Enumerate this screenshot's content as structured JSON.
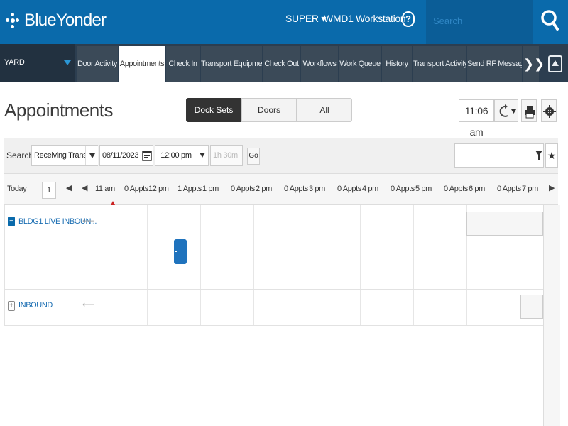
{
  "header": {
    "brand": "BlueYonder",
    "user_menu": "SUPER ▾",
    "warehouse": "WMD1",
    "workstation": "Workstation",
    "help": "?",
    "search_placeholder": "Search"
  },
  "tabbar": {
    "yard_label": "YARD",
    "tabs": [
      {
        "label": "Door Activity"
      },
      {
        "label": "Appointments"
      },
      {
        "label": "Check In"
      },
      {
        "label": "Transport Equipment"
      },
      {
        "label": "Check Out"
      },
      {
        "label": "Workflows"
      },
      {
        "label": "Work Queue"
      },
      {
        "label": "History"
      },
      {
        "label": "Transport Activity"
      },
      {
        "label": "Send RF Message"
      }
    ],
    "more": "❯❯",
    "active_tab": "Appointments"
  },
  "page": {
    "title": "Appointments",
    "view_toggle": [
      "Dock Sets",
      "Doors",
      "All"
    ],
    "active_view": "Dock Sets",
    "clock": "11:06 am"
  },
  "search": {
    "label": "Search:",
    "type_value": "Receiving Transport",
    "date_value": "08/11/2023",
    "time_value": "12:00 pm",
    "duration_placeholder": "1h 30m",
    "go_label": "Go",
    "star": "★"
  },
  "timeline": {
    "today_label": "Today",
    "today_value": "1",
    "slots": [
      {
        "time": "11 am",
        "appts": "0 Appts"
      },
      {
        "time": "12 pm",
        "appts": "1 Appts"
      },
      {
        "time": "1 pm",
        "appts": "0 Appts"
      },
      {
        "time": "2 pm",
        "appts": "0 Appts"
      },
      {
        "time": "3 pm",
        "appts": "0 Appts"
      },
      {
        "time": "4 pm",
        "appts": "0 Appts"
      },
      {
        "time": "5 pm",
        "appts": "0 Appts"
      },
      {
        "time": "6 pm",
        "appts": "0 Appts"
      },
      {
        "time": "7 pm",
        "appts": ""
      }
    ],
    "groups": [
      {
        "label": "BLDG1 LIVE INBOUN...",
        "toggle": "−",
        "pin": "⟵"
      },
      {
        "label": "INBOUND",
        "toggle": "+",
        "pin": "⟵"
      }
    ]
  },
  "colors": {
    "brand": "#0a6aab",
    "tabbar": "#2c3e50",
    "appointment": "#1f73bd",
    "now_marker": "#cc2222"
  }
}
